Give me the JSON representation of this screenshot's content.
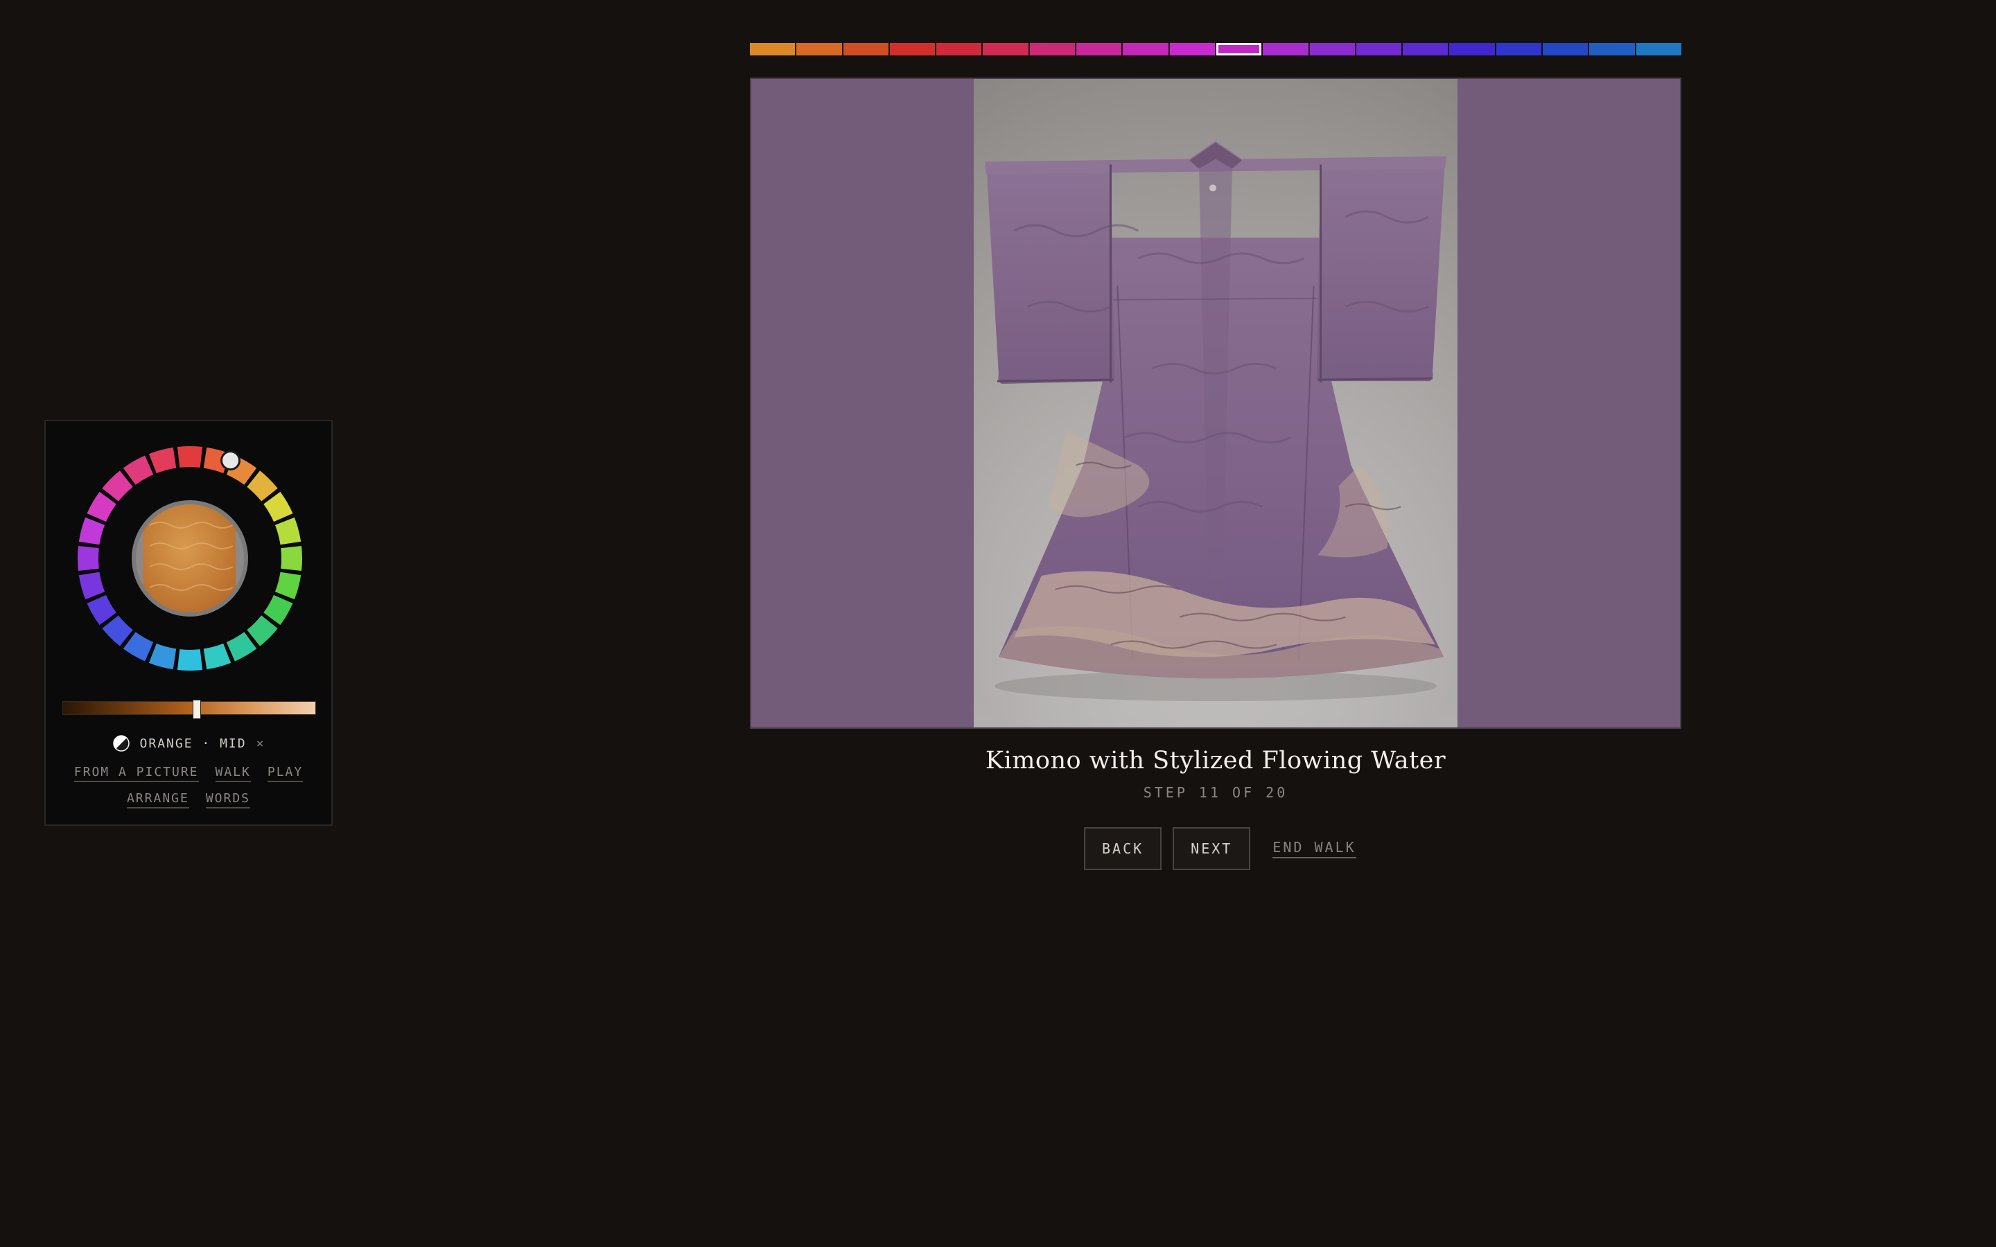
{
  "color_strip": {
    "active_index": 10,
    "colors": [
      "#dd8826",
      "#d86a26",
      "#cf4f22",
      "#d1302a",
      "#cf2a3a",
      "#d02a55",
      "#cc2a78",
      "#c9289a",
      "#c328b7",
      "#c82ad0",
      "#c028c6",
      "#a92ccf",
      "#8b2cd0",
      "#722ad2",
      "#5a2ad2",
      "#4226d0",
      "#2f36cc",
      "#2447c4",
      "#215ec2",
      "#1f78c2"
    ]
  },
  "artwork": {
    "title": "Kimono with Stylized Flowing Water",
    "step_label": "STEP 11 OF 20"
  },
  "controls": {
    "back_label": "BACK",
    "next_label": "NEXT",
    "end_label": "END WALK"
  },
  "panel": {
    "wheel_colors": [
      "#e23b3d",
      "#e8603a",
      "#e8893a",
      "#e2b23a",
      "#d8d83b",
      "#b6dc3c",
      "#88d83e",
      "#5fd340",
      "#44cc52",
      "#36c877",
      "#30c69c",
      "#32c8c4",
      "#2fbfdf",
      "#3596de",
      "#3a6ee0",
      "#4450e0",
      "#5a3ce0",
      "#7a36de",
      "#9d36dd",
      "#c13ad9",
      "#d63ac2",
      "#de3aa0",
      "#e03a7e",
      "#e23b5c"
    ],
    "selected_color_name": "ORANGE",
    "selected_shade": "MID",
    "separator": "·",
    "clear_symbol": "×",
    "shade_level": 0.53,
    "nav_row_1": [
      "FROM A PICTURE",
      "WALK",
      "PLAY"
    ],
    "nav_row_2": [
      "ARRANGE",
      "WORDS"
    ]
  }
}
